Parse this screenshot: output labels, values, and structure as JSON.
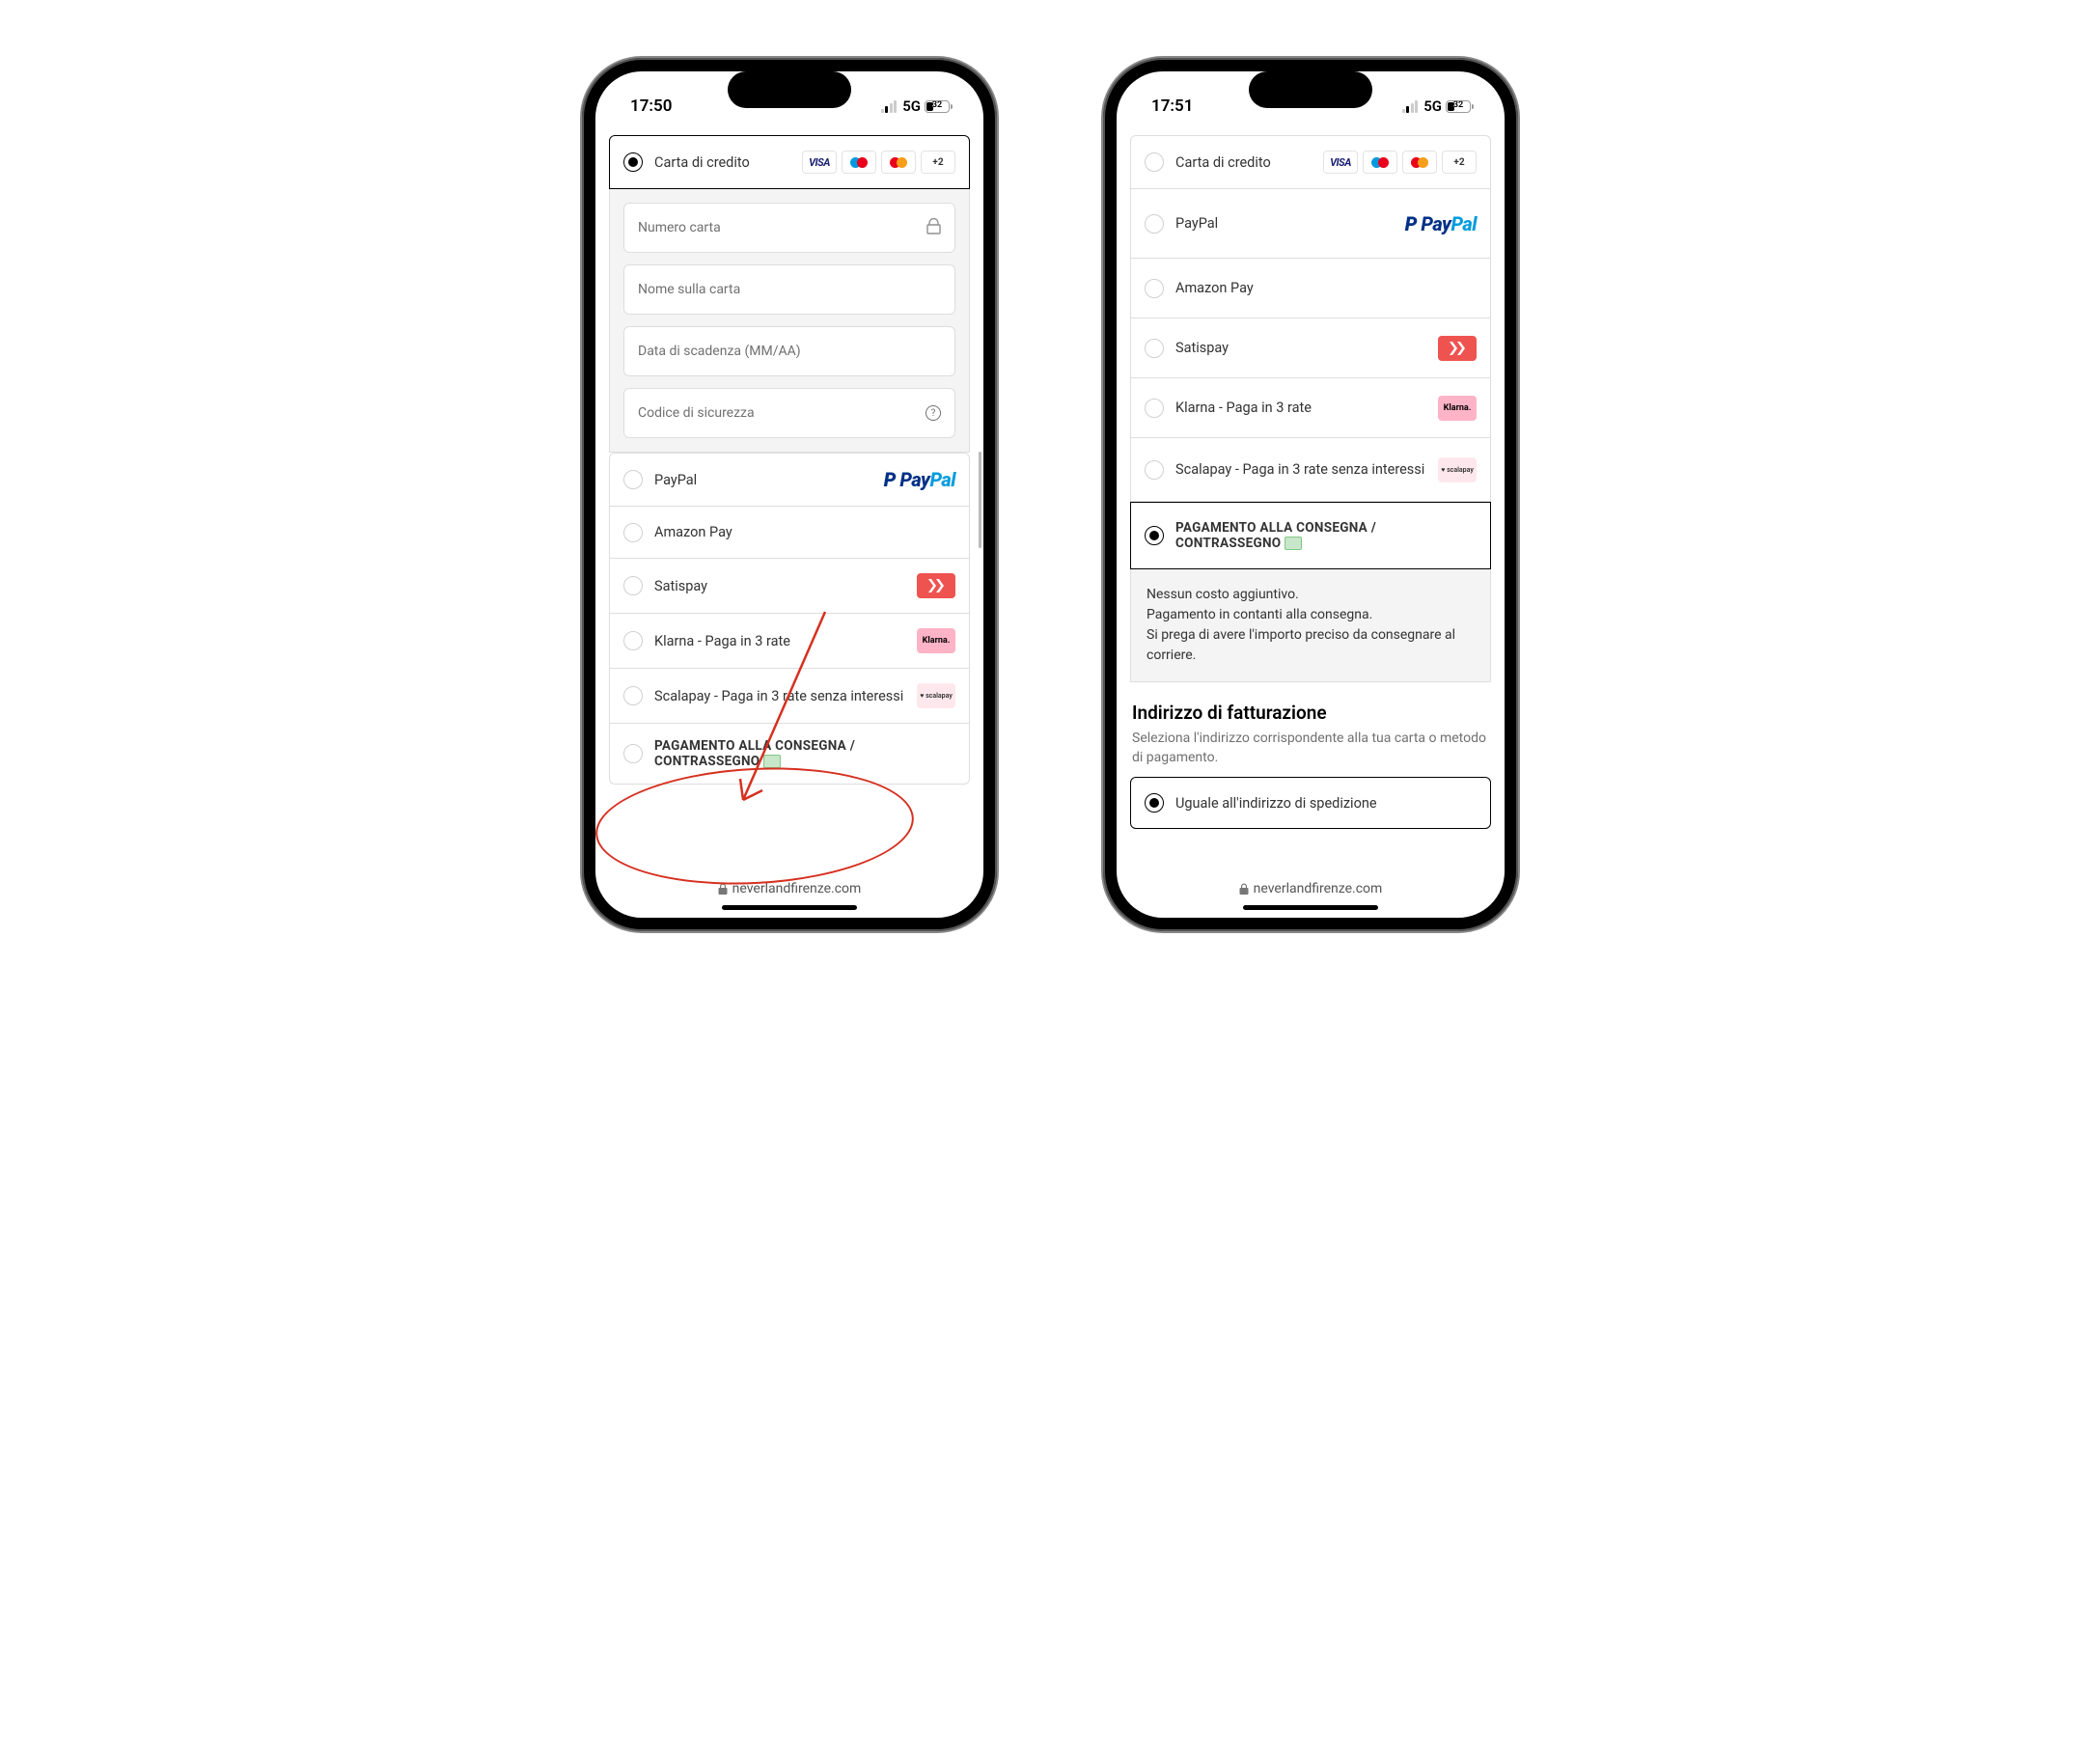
{
  "phone_left": {
    "status": {
      "time": "17:50",
      "network": "5G",
      "battery": "32"
    },
    "payments": {
      "credit_card": {
        "label": "Carta di credito",
        "more_badge": "+2",
        "form": {
          "card_number_placeholder": "Numero carta",
          "name_placeholder": "Nome sulla carta",
          "expiry_placeholder": "Data di scadenza (MM/AA)",
          "cvv_placeholder": "Codice di sicurezza"
        }
      },
      "options": [
        {
          "label": "PayPal",
          "brand": "paypal"
        },
        {
          "label": "Amazon Pay",
          "brand": "amazon"
        },
        {
          "label": "Satispay",
          "brand": "satispay"
        },
        {
          "label": "Klarna - Paga in 3 rate",
          "brand": "klarna"
        },
        {
          "label": "Scalapay - Paga in 3 rate senza interessi",
          "brand": "scalapay"
        }
      ],
      "cod_label": "PAGAMENTO ALLA CONSEGNA / CONTRASSEGNO"
    },
    "url": "neverlandfirenze.com"
  },
  "phone_right": {
    "status": {
      "time": "17:51",
      "network": "5G",
      "battery": "32"
    },
    "payments": {
      "credit_card": {
        "label": "Carta di credito",
        "more_badge": "+2"
      },
      "options": [
        {
          "label": "PayPal",
          "brand": "paypal"
        },
        {
          "label": "Amazon Pay",
          "brand": "amazon"
        },
        {
          "label": "Satispay",
          "brand": "satispay"
        },
        {
          "label": "Klarna - Paga in 3 rate",
          "brand": "klarna"
        },
        {
          "label": "Scalapay - Paga in 3 rate senza interessi",
          "brand": "scalapay"
        }
      ],
      "cod_label": "PAGAMENTO ALLA CONSEGNA / CONTRASSEGNO",
      "cod_details": {
        "line1": "Nessun costo aggiuntivo.",
        "line2": "Pagamento in contanti alla consegna.",
        "line3": "Si prega di avere l'importo preciso da consegnare al corriere."
      }
    },
    "billing": {
      "title": "Indirizzo di fatturazione",
      "subtitle": "Seleziona l'indirizzo corrispondente alla tua carta o metodo di pagamento.",
      "same_as_shipping": "Uguale all'indirizzo di spedizione"
    },
    "url": "neverlandfirenze.com"
  },
  "brands": {
    "visa": "VISA",
    "klarna": "Klarna.",
    "scalapay": "♥ scalapay",
    "paypal_p": "Pay",
    "paypal_pal": "Pal"
  }
}
